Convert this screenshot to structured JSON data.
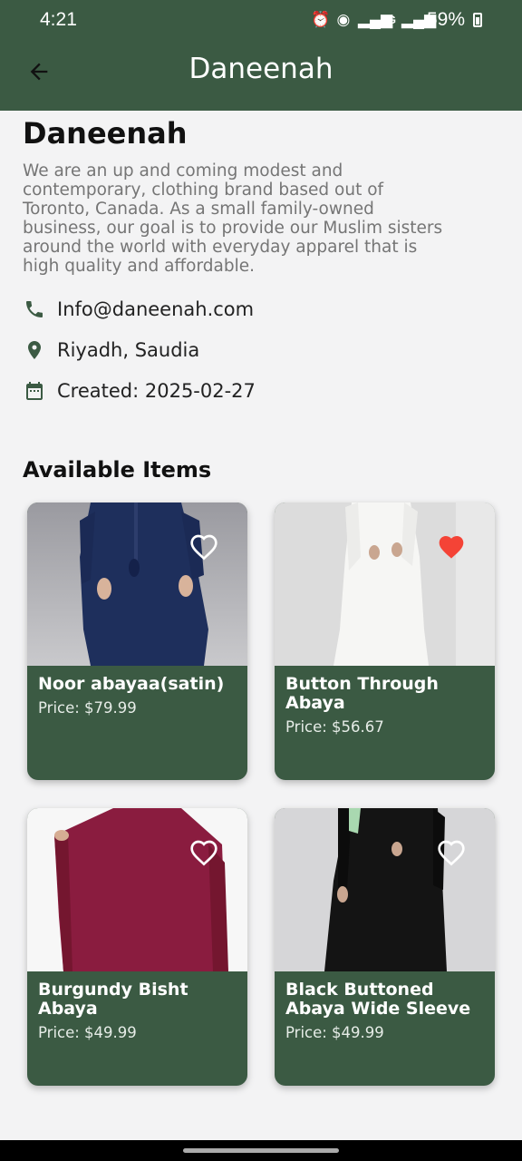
{
  "status_bar": {
    "time": "4:21",
    "network": "4G",
    "battery_percent": "59%"
  },
  "app_bar": {
    "title": "Daneenah",
    "back_icon": "arrow-back-icon"
  },
  "store": {
    "name": "Daneenah",
    "description_lines": [
      "We are an up and coming modest and",
      "contemporary, clothing brand based out of",
      "Toronto, Canada. As a small family-owned",
      "business, our goal is to provide our Muslim sisters",
      "around the world with everyday apparel that is",
      "high quality and affordable."
    ],
    "email": "Info@daneenah.com",
    "location": "Riyadh, Saudia",
    "created": "Created: 2025-02-27"
  },
  "items_section": {
    "title": "Available Items",
    "items": [
      {
        "name": "Noor abayaa(satin)",
        "price": "Price: $79.99",
        "favorited": false
      },
      {
        "name": "Button Through Abaya",
        "price": "Price: $56.67",
        "favorited": true
      },
      {
        "name": "Burgundy Bisht Abaya",
        "price": "Price: $49.99",
        "favorited": false
      },
      {
        "name": "Black Buttoned Abaya Wide Sleeve",
        "price": "Price: $49.99",
        "favorited": false
      }
    ]
  },
  "colors": {
    "primary": "#3b5a43",
    "favorite_active": "#f44336",
    "background": "#f3f3f4"
  }
}
